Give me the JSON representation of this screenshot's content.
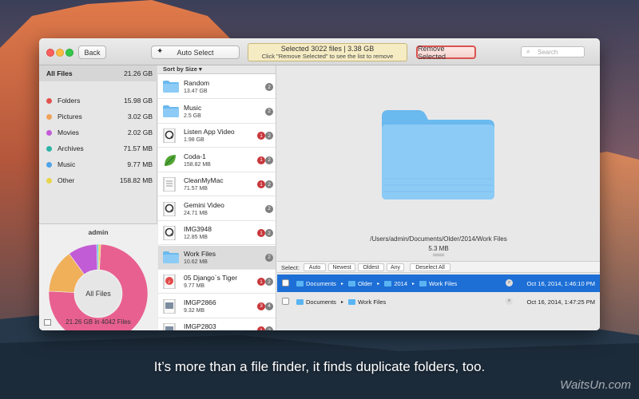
{
  "toolbar": {
    "back_label": "Back",
    "auto_select_label": "Auto Select",
    "status_line1": "Selected 3022 files | 3.38 GB",
    "status_line2": "Click \"Remove Selected\" to see the list to remove",
    "remove_label": "Remove Selected",
    "search_placeholder": "Search"
  },
  "sidebar": {
    "categories": [
      {
        "label": "All Files",
        "size": "21.26 GB",
        "color": ""
      },
      {
        "label": "Folders",
        "size": "15.98 GB",
        "color": "#e2534f"
      },
      {
        "label": "Pictures",
        "size": "3.02 GB",
        "color": "#f0a25a"
      },
      {
        "label": "Movies",
        "size": "2.02 GB",
        "color": "#c25bd6"
      },
      {
        "label": "Archives",
        "size": "71.57 MB",
        "color": "#2fb3a7"
      },
      {
        "label": "Music",
        "size": "9.77 MB",
        "color": "#4fa3e8"
      },
      {
        "label": "Other",
        "size": "158.82 MB",
        "color": "#e8d54a"
      }
    ],
    "user": "admin",
    "pie_center": "All Files",
    "footer": "21.26 GB in 4042 Files"
  },
  "list": {
    "sort_label": "Sort by Size",
    "items": [
      {
        "name": "Random",
        "size": "13.47 GB",
        "red": "",
        "grey": "2",
        "icon": "folder-icon"
      },
      {
        "name": "Music",
        "size": "2.5 GB",
        "red": "",
        "grey": "2",
        "icon": "folder-icon"
      },
      {
        "name": "Listen App Video",
        "size": "1.98 GB",
        "red": "1",
        "grey": "2",
        "icon": "quicktime-icon"
      },
      {
        "name": "Coda-1",
        "size": "158.82 MB",
        "red": "1",
        "grey": "2",
        "icon": "leaf-icon"
      },
      {
        "name": "CleanMyMac",
        "size": "71.57 MB",
        "red": "1",
        "grey": "2",
        "icon": "document-icon"
      },
      {
        "name": "Gemini Video",
        "size": "24.71 MB",
        "red": "",
        "grey": "2",
        "icon": "quicktime-icon"
      },
      {
        "name": "IMG3948",
        "size": "12.85 MB",
        "red": "1",
        "grey": "2",
        "icon": "quicktime-icon"
      },
      {
        "name": "Work Files",
        "size": "10.62 MB",
        "red": "",
        "grey": "2",
        "icon": "folder-icon"
      },
      {
        "name": "05 Django`s Tiger",
        "size": "9.77 MB",
        "red": "1",
        "grey": "2",
        "icon": "music-file-icon"
      },
      {
        "name": "IMGP2866",
        "size": "9.32 MB",
        "red": "3",
        "grey": "4",
        "icon": "image-file-icon"
      },
      {
        "name": "IMGP2803",
        "size": "",
        "red": "1",
        "grey": "2",
        "icon": "image-file-icon"
      }
    ]
  },
  "detail": {
    "path": "/Users/admin/Documents/Older/2014/Work Files",
    "size": "5.3 MB",
    "select_label": "Select:",
    "select_buttons": [
      "Auto",
      "Newest",
      "Oldest",
      "Any"
    ],
    "deselect_label": "Deselect All",
    "duplicates": [
      {
        "crumbs": [
          "Documents",
          "Older",
          "2014",
          "Work Files"
        ],
        "date": "Oct 16, 2014, 1:46:10 PM"
      },
      {
        "crumbs": [
          "Documents",
          "Work Files"
        ],
        "date": "Oct 16, 2014, 1:47:25 PM"
      }
    ]
  },
  "caption": "It’s more than a file finder, it finds duplicate folders, too.",
  "watermark": "WaitsUn.com",
  "pie": {
    "shares": [
      {
        "category": "Folders",
        "fraction": 0.75,
        "color": "#e8608f"
      },
      {
        "category": "Pictures",
        "fraction": 0.142,
        "color": "#f0b05a"
      },
      {
        "category": "Movies",
        "fraction": 0.095,
        "color": "#c25bd6"
      },
      {
        "category": "Music",
        "fraction": 0.006,
        "color": "#5bc4e8"
      },
      {
        "category": "Other",
        "fraction": 0.007,
        "color": "#e8d54a"
      }
    ]
  }
}
